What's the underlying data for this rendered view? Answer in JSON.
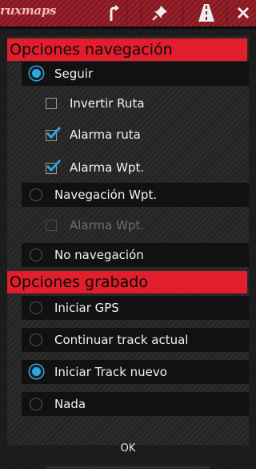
{
  "app": {
    "logo_text": "ruxmaps",
    "accent": "#e21d2c",
    "toolbar_icons": [
      "turn-arrow-icon",
      "pin-icon",
      "road-icon",
      "close-icon"
    ]
  },
  "sections": {
    "navigation": {
      "title": "Opciones navegación",
      "items": [
        {
          "label": "Seguir",
          "type": "radio",
          "checked": true
        },
        {
          "label": "Invertir Ruta",
          "type": "checkbox",
          "checked": false
        },
        {
          "label": "Alarma ruta",
          "type": "checkbox",
          "checked": true
        },
        {
          "label": "Alarma Wpt.",
          "type": "checkbox",
          "checked": true
        },
        {
          "label": "Navegación Wpt.",
          "type": "radio",
          "checked": false
        },
        {
          "label": "Alarma Wpt.",
          "type": "checkbox",
          "checked": false,
          "disabled": true
        },
        {
          "label": "No navegación",
          "type": "radio",
          "checked": false
        }
      ]
    },
    "recording": {
      "title": "Opciones grabado",
      "items": [
        {
          "label": "Iniciar GPS",
          "type": "radio",
          "checked": false
        },
        {
          "label": "Continuar track actual",
          "type": "radio",
          "checked": false
        },
        {
          "label": "Iniciar Track nuevo",
          "type": "radio",
          "checked": true
        },
        {
          "label": "Nada",
          "type": "radio",
          "checked": false
        }
      ]
    }
  },
  "dialog": {
    "ok_label": "OK"
  }
}
